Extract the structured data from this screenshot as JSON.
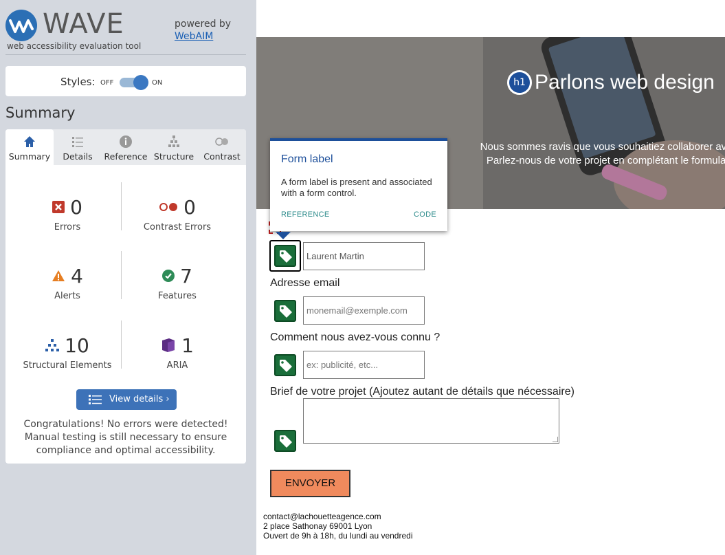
{
  "wave": {
    "logo_text": "WAVE",
    "logo_subtitle": "web accessibility evaluation tool",
    "powered_by": "powered by",
    "powered_link": "WebAIM",
    "styles_label": "Styles:",
    "toggle_off": "OFF",
    "toggle_on": "ON",
    "summary_title": "Summary",
    "tabs": [
      {
        "label": "Summary",
        "icon": "home-icon",
        "active": true
      },
      {
        "label": "Details",
        "icon": "list-icon",
        "active": false
      },
      {
        "label": "Reference",
        "icon": "info-icon",
        "active": false
      },
      {
        "label": "Structure",
        "icon": "structure-icon",
        "active": false
      },
      {
        "label": "Contrast",
        "icon": "contrast-icon",
        "active": false
      }
    ],
    "stats": {
      "errors": {
        "count": "0",
        "label": "Errors"
      },
      "contrast_errors": {
        "count": "0",
        "label": "Contrast Errors"
      },
      "alerts": {
        "count": "4",
        "label": "Alerts"
      },
      "features": {
        "count": "7",
        "label": "Features"
      },
      "structural": {
        "count": "10",
        "label": "Structural Elements"
      },
      "aria": {
        "count": "1",
        "label": "ARIA"
      }
    },
    "view_details": "View details ›",
    "congrats": "Congratulations! No errors were detected! Manual testing is still necessary to ensure compliance and optimal accessibility."
  },
  "page": {
    "h1_badge": "h1",
    "hero_title": "Parlons web design",
    "hero_line1": "Nous sommes ravis que vous souhaitiez collaborer avec",
    "hero_line2": "Parlez-nous de votre projet en complétant le formulaire",
    "tooltip": {
      "title": "Form label",
      "body": "A form label is present and associated with a form control.",
      "reference": "REFERENCE",
      "code": "CODE"
    },
    "fields": {
      "name_value": "Laurent Martin",
      "email_label": "Adresse email",
      "email_placeholder": "monemail@exemple.com",
      "source_label": "Comment nous avez-vous connu ?",
      "source_placeholder": "ex: publicité, etc...",
      "brief_label": "Brief de votre projet (Ajoutez autant de détails que nécessaire)"
    },
    "send_button": "ENVOYER",
    "footer": {
      "email": "contact@lachouetteagence.com",
      "address": "2 place Sathonay 69001 Lyon",
      "hours": "Ouvert de 9h à 18h, du lundi au vendredi"
    }
  },
  "colors": {
    "accent": "#1d4f9a",
    "error": "#c0392b",
    "alert": "#e67e22",
    "feature": "#2e8b57",
    "aria": "#5b2c83",
    "send_button": "#f08a5d"
  }
}
